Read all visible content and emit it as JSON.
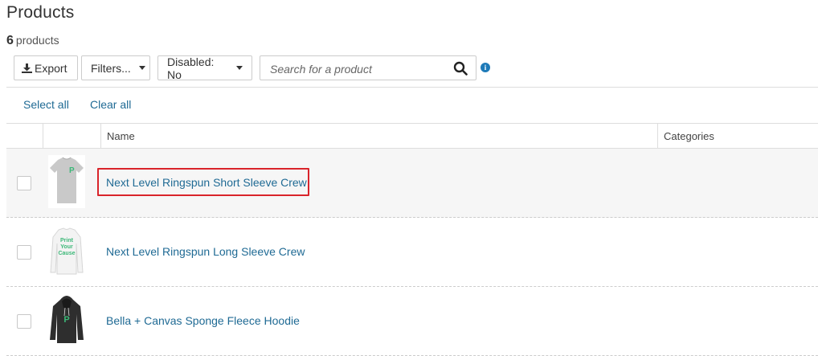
{
  "page": {
    "title": "Products",
    "count_number": "6",
    "count_label": "products"
  },
  "toolbar": {
    "export_label": "Export",
    "filters_label": "Filters...",
    "disabled_label": "Disabled: No",
    "search_placeholder": "Search for a product",
    "search_value": ""
  },
  "selection": {
    "select_all": "Select all",
    "clear_all": "Clear all"
  },
  "table": {
    "columns": [
      "",
      "",
      "Name",
      "Categories"
    ],
    "rows": [
      {
        "name": "Next Level Ringspun Short Sleeve Crew",
        "category": "",
        "image": "grey-tshirt",
        "highlighted": true
      },
      {
        "name": "Next Level Ringspun Long Sleeve Crew",
        "category": "",
        "image": "white-longsleeve",
        "highlighted": false
      },
      {
        "name": "Bella + Canvas Sponge Fleece Hoodie",
        "category": "",
        "image": "black-hoodie",
        "highlighted": false
      }
    ]
  },
  "thumb_text": {
    "longsleeve": [
      "Print",
      "Your",
      "Cause"
    ]
  },
  "colors": {
    "link": "#1f6a94",
    "info": "#1e7ab8",
    "highlight": "#d9242b",
    "brand_green": "#3cb878"
  }
}
